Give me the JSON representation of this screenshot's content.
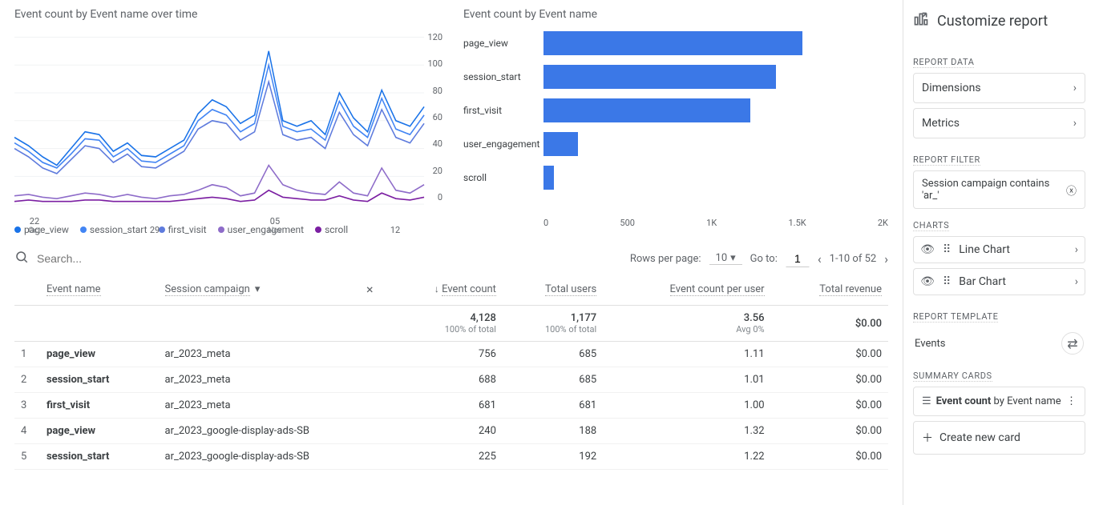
{
  "titles": {
    "line_chart": "Event count by Event name over time",
    "bar_chart": "Event count by Event name"
  },
  "chart_data": [
    {
      "type": "line",
      "ylim": [
        0,
        120
      ],
      "yticks": [
        0,
        20,
        40,
        60,
        80,
        100,
        120
      ],
      "xticks": [
        {
          "label": "22",
          "sub": "Oct"
        },
        {
          "label": "29",
          "sub": ""
        },
        {
          "label": "05",
          "sub": "Nov"
        },
        {
          "label": "12",
          "sub": ""
        }
      ],
      "series": [
        {
          "name": "page_view",
          "color": "#1a73e8",
          "values": [
            48,
            42,
            34,
            28,
            40,
            52,
            50,
            38,
            44,
            35,
            34,
            40,
            46,
            65,
            75,
            70,
            58,
            64,
            110,
            60,
            56,
            60,
            50,
            80,
            62,
            52,
            82,
            60,
            56,
            70
          ]
        },
        {
          "name": "session_start",
          "color": "#4285f4",
          "values": [
            44,
            38,
            30,
            26,
            36,
            47,
            46,
            34,
            40,
            31,
            30,
            36,
            42,
            60,
            68,
            64,
            52,
            58,
            100,
            56,
            52,
            54,
            46,
            74,
            56,
            48,
            76,
            54,
            50,
            64
          ]
        },
        {
          "name": "first_visit",
          "color": "#5e7bdd",
          "values": [
            40,
            34,
            26,
            22,
            32,
            42,
            40,
            30,
            36,
            27,
            26,
            32,
            38,
            54,
            60,
            58,
            46,
            52,
            88,
            50,
            46,
            48,
            40,
            66,
            50,
            42,
            68,
            48,
            44,
            58
          ]
        },
        {
          "name": "user_engagement",
          "color": "#8e6cc9",
          "values": [
            6,
            7,
            5,
            4,
            6,
            8,
            7,
            5,
            7,
            5,
            4,
            6,
            7,
            10,
            14,
            12,
            6,
            8,
            28,
            14,
            10,
            8,
            7,
            16,
            8,
            6,
            26,
            10,
            8,
            14
          ]
        },
        {
          "name": "scroll",
          "color": "#7b1fa2",
          "values": [
            2,
            3,
            2,
            2,
            2,
            3,
            3,
            2,
            2,
            2,
            2,
            2,
            3,
            4,
            5,
            4,
            2,
            3,
            10,
            5,
            4,
            3,
            3,
            6,
            3,
            2,
            8,
            4,
            3,
            5
          ]
        }
      ]
    },
    {
      "type": "bar",
      "xlim": [
        0,
        2000
      ],
      "xticks": [
        "0",
        "500",
        "1K",
        "1.5K",
        "2K"
      ],
      "categories": [
        "page_view",
        "session_start",
        "first_visit",
        "user_engagement",
        "scroll"
      ],
      "values": [
        1500,
        1350,
        1200,
        200,
        60
      ]
    }
  ],
  "legend": [
    "page_view",
    "session_start",
    "first_visit",
    "user_engagement",
    "scroll"
  ],
  "legend_colors": [
    "#1a73e8",
    "#4285f4",
    "#5e7bdd",
    "#8e6cc9",
    "#7b1fa2"
  ],
  "search": {
    "placeholder": "Search..."
  },
  "pagination": {
    "rows_label": "Rows per page:",
    "rows_per_page": "10",
    "goto_label": "Go to:",
    "goto_value": "1",
    "range": "1-10 of 52"
  },
  "table": {
    "headers": {
      "event_name": "Event name",
      "session_campaign": "Session campaign",
      "event_count": "Event count",
      "total_users": "Total users",
      "event_count_per_user": "Event count per user",
      "total_revenue": "Total revenue"
    },
    "totals": {
      "event_count": "4,128",
      "event_count_sub": "100% of total",
      "total_users": "1,177",
      "total_users_sub": "100% of total",
      "ecpu": "3.56",
      "ecpu_sub": "Avg 0%",
      "revenue": "$0.00"
    },
    "rows": [
      {
        "n": "1",
        "event": "page_view",
        "campaign": "ar_2023_meta",
        "ec": "756",
        "tu": "685",
        "ecpu": "1.11",
        "rev": "$0.00"
      },
      {
        "n": "2",
        "event": "session_start",
        "campaign": "ar_2023_meta",
        "ec": "688",
        "tu": "685",
        "ecpu": "1.01",
        "rev": "$0.00"
      },
      {
        "n": "3",
        "event": "first_visit",
        "campaign": "ar_2023_meta",
        "ec": "681",
        "tu": "681",
        "ecpu": "1.00",
        "rev": "$0.00"
      },
      {
        "n": "4",
        "event": "page_view",
        "campaign": "ar_2023_google-display-ads-SB",
        "ec": "240",
        "tu": "188",
        "ecpu": "1.32",
        "rev": "$0.00"
      },
      {
        "n": "5",
        "event": "session_start",
        "campaign": "ar_2023_google-display-ads-SB",
        "ec": "225",
        "tu": "192",
        "ecpu": "1.22",
        "rev": "$0.00"
      }
    ]
  },
  "right": {
    "title": "Customize report",
    "report_data": "REPORT DATA",
    "dimensions": "Dimensions",
    "metrics": "Metrics",
    "report_filter": "REPORT FILTER",
    "filter_chip": "Session campaign contains 'ar_'",
    "charts": "CHARTS",
    "line_chart": "Line Chart",
    "bar_chart": "Bar Chart",
    "report_template": "REPORT TEMPLATE",
    "template_name": "Events",
    "summary_cards": "SUMMARY CARDS",
    "summary_text_b": "Event count",
    "summary_text_r": " by Event name",
    "create_card": "Create new card"
  }
}
